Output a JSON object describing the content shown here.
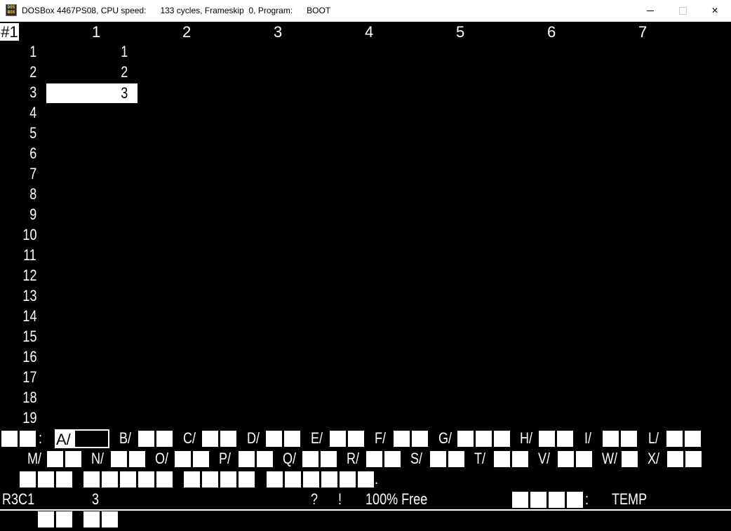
{
  "titlebar": {
    "title": "DOSBox 4467PS08, CPU speed:      133 cycles, Frameskip  0, Program:      BOOT",
    "icon": "dosbox-icon",
    "minimize_glyph": "",
    "maximize_glyph": "",
    "close_glyph": "✕"
  },
  "sheet": {
    "id_label": "#1",
    "columns": [
      "1",
      "2",
      "3",
      "4",
      "5",
      "6",
      "7"
    ],
    "rows": [
      "1",
      "2",
      "3",
      "4",
      "5",
      "6",
      "7",
      "8",
      "9",
      "10",
      "11",
      "12",
      "13",
      "14",
      "15",
      "16",
      "17",
      "18",
      "19"
    ],
    "cells": {
      "r1c1": "1",
      "r2c1": "2",
      "r3c1": "3"
    },
    "selected": "r3c1"
  },
  "menu": {
    "colon": ":",
    "items": [
      "A/",
      "B/",
      "C/",
      "D/",
      "E/",
      "F/",
      "G/",
      "H/",
      "I/",
      "L/",
      "M/",
      "N/",
      "O/",
      "P/",
      "Q/",
      "R/",
      "S/",
      "T/",
      "V/",
      "W/",
      "X/"
    ],
    "period": "."
  },
  "status": {
    "cell_ref": "R3C1",
    "cell_value": "3",
    "question": "?",
    "bang": "!",
    "free": "100% Free",
    "file_colon": ":",
    "file_name": "TEMP"
  }
}
